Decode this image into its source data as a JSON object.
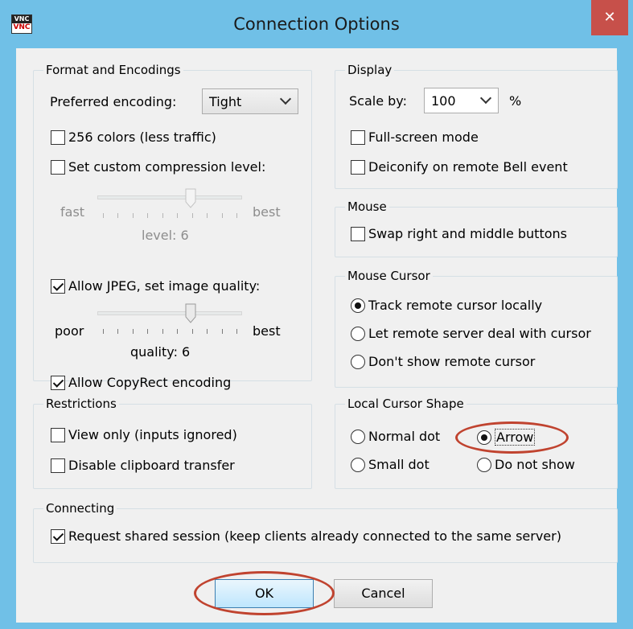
{
  "window": {
    "title": "Connection Options",
    "close_label": "✕",
    "app_icon_top": "VNC",
    "app_icon_bottom": "VNC"
  },
  "format": {
    "title": "Format and Encodings",
    "preferred_encoding_label": "Preferred encoding:",
    "preferred_encoding_value": "Tight",
    "colors256": {
      "label": "256 colors (less traffic)",
      "checked": false
    },
    "custom_compression": {
      "label": "Set custom compression level:",
      "checked": false
    },
    "compression_slider": {
      "left": "fast",
      "right": "best",
      "value_text": "level: 6",
      "value": 6,
      "max": 9,
      "enabled": false
    },
    "allow_jpeg": {
      "label": "Allow JPEG, set image quality:",
      "checked": true
    },
    "quality_slider": {
      "left": "poor",
      "right": "best",
      "value_text": "quality: 6",
      "value": 6,
      "max": 9,
      "enabled": true
    },
    "copyrect": {
      "label": "Allow CopyRect encoding",
      "checked": true
    }
  },
  "restrictions": {
    "title": "Restrictions",
    "view_only": {
      "label": "View only (inputs ignored)",
      "checked": false
    },
    "disable_clipboard": {
      "label": "Disable clipboard transfer",
      "checked": false
    }
  },
  "display": {
    "title": "Display",
    "scale_label": "Scale by:",
    "scale_value": "100",
    "scale_unit": "%",
    "fullscreen": {
      "label": "Full-screen mode",
      "checked": false
    },
    "deiconify": {
      "label": "Deiconify on remote Bell event",
      "checked": false
    }
  },
  "mouse": {
    "title": "Mouse",
    "swap": {
      "label": "Swap right and middle buttons",
      "checked": false
    }
  },
  "mouse_cursor": {
    "title": "Mouse Cursor",
    "options": [
      {
        "label": "Track remote cursor locally",
        "checked": true
      },
      {
        "label": "Let remote server deal with cursor",
        "checked": false
      },
      {
        "label": "Don't show remote cursor",
        "checked": false
      }
    ]
  },
  "local_cursor": {
    "title": "Local Cursor Shape",
    "normal_dot": {
      "label": "Normal dot",
      "checked": false
    },
    "arrow": {
      "label": "Arrow",
      "checked": true
    },
    "small_dot": {
      "label": "Small dot",
      "checked": false
    },
    "do_not_show": {
      "label": "Do not show",
      "checked": false
    }
  },
  "connecting": {
    "title": "Connecting",
    "shared": {
      "label": "Request shared session (keep clients already connected to the same server)",
      "checked": true
    }
  },
  "buttons": {
    "ok": "OK",
    "cancel": "Cancel"
  },
  "colors": {
    "title_bar": "#70c0e7",
    "close_button": "#c7504a",
    "annotation_oval": "#c0432f"
  }
}
